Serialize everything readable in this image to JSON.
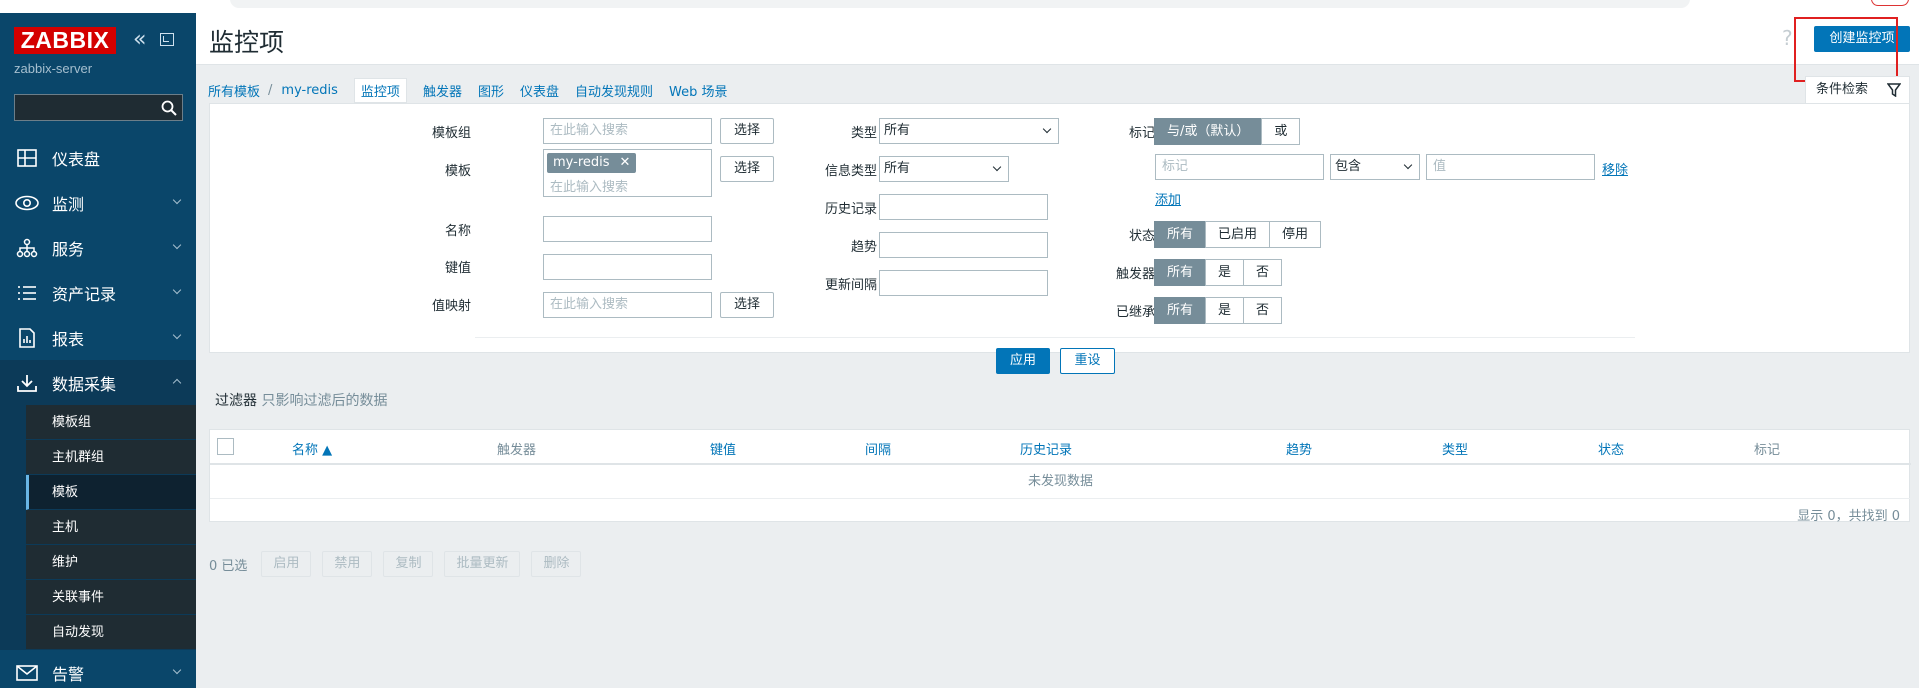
{
  "app": {
    "logo": "ZABBIX",
    "server": "zabbix-server"
  },
  "sidebar": {
    "items": [
      {
        "label": "仪表盘",
        "icon": "dashboard-icon"
      },
      {
        "label": "监测",
        "icon": "eye-icon"
      },
      {
        "label": "服务",
        "icon": "services-icon"
      },
      {
        "label": "资产记录",
        "icon": "list-icon"
      },
      {
        "label": "报表",
        "icon": "report-icon"
      },
      {
        "label": "数据采集",
        "icon": "download-icon"
      }
    ],
    "sub_items": [
      "模板组",
      "主机群组",
      "模板",
      "主机",
      "维护",
      "关联事件",
      "自动发现"
    ],
    "active_sub": "模板",
    "alerts": {
      "label": "告警",
      "icon": "mail-icon"
    }
  },
  "header": {
    "title": "监控项",
    "help": "?",
    "create_label": "创建监控项"
  },
  "breadcrumb": {
    "all_templates": "所有模板",
    "separator": "/",
    "template": "my-redis",
    "current": "监控项",
    "tabs": [
      "触发器",
      "图形",
      "仪表盘",
      "自动发现规则",
      "Web 场景"
    ]
  },
  "filter_tab": {
    "label": "条件检索"
  },
  "filter": {
    "template_group": {
      "label": "模板组",
      "placeholder": "在此输入搜索",
      "button": "选择"
    },
    "template": {
      "label": "模板",
      "chip": "my-redis",
      "placeholder": "在此输入搜索",
      "button": "选择"
    },
    "name": {
      "label": "名称",
      "value": ""
    },
    "key": {
      "label": "键值",
      "value": ""
    },
    "value_map": {
      "label": "值映射",
      "placeholder": "在此输入搜索",
      "button": "选择"
    },
    "type": {
      "label": "类型",
      "value": "所有"
    },
    "info_type": {
      "label": "信息类型",
      "value": "所有"
    },
    "history": {
      "label": "历史记录",
      "value": ""
    },
    "trends": {
      "label": "趋势",
      "value": ""
    },
    "interval": {
      "label": "更新间隔",
      "value": ""
    },
    "tags": {
      "label": "标记",
      "op_options": [
        "与/或（默认）",
        "或"
      ],
      "tag_placeholder": "标记",
      "condition": "包含",
      "value_placeholder": "值",
      "remove": "移除",
      "add": "添加"
    },
    "status": {
      "label": "状态",
      "options": [
        "所有",
        "已启用",
        "停用"
      ]
    },
    "triggers": {
      "label": "触发器",
      "options": [
        "所有",
        "是",
        "否"
      ]
    },
    "inherited": {
      "label": "已继承",
      "options": [
        "所有",
        "是",
        "否"
      ]
    },
    "apply": "应用",
    "reset": "重设"
  },
  "filter_note": {
    "title": "过滤器",
    "subtitle": "只影响过滤后的数据"
  },
  "table": {
    "columns": [
      "名称 ▲",
      "触发器",
      "键值",
      "间隔",
      "历史记录",
      "趋势",
      "类型",
      "状态",
      "标记"
    ],
    "empty": "未发现数据",
    "count": "显示 0，共找到 0"
  },
  "actions": {
    "selected": "0 已选",
    "buttons": [
      "启用",
      "禁用",
      "复制",
      "批量更新",
      "删除"
    ]
  }
}
